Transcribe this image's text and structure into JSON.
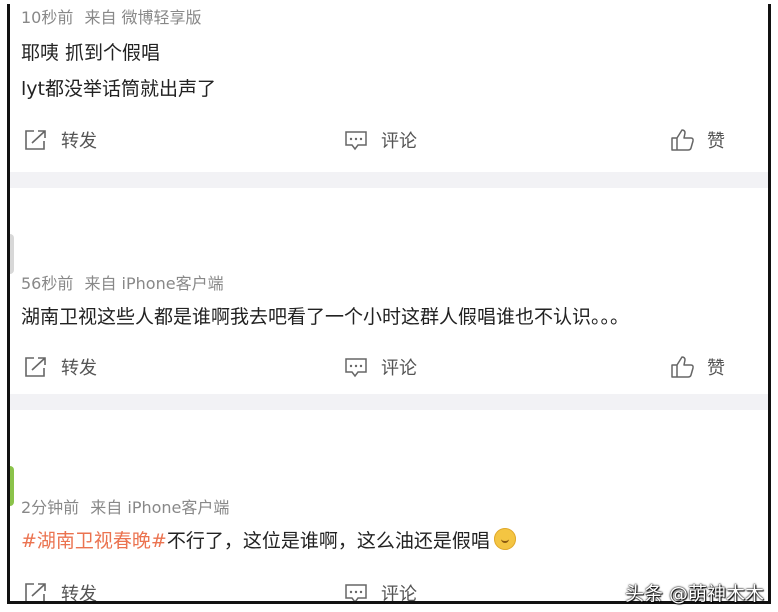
{
  "comments": [
    {
      "time": "10秒前",
      "source": "来自 微博轻享版",
      "lines": [
        "耶咦 抓到个假唱",
        "lyt都没举话筒就出声了"
      ]
    },
    {
      "time": "56秒前",
      "source": "来自 iPhone客户端",
      "lines": [
        "湖南卫视这些人都是谁啊我去吧看了一个小时这群人假唱谁也不认识。。。"
      ]
    },
    {
      "time": "2分钟前",
      "source": "来自 iPhone客户端",
      "hashtag": "#湖南卫视春晚#",
      "text_after_hashtag": "不行了，这位是谁啊，这么油还是假唱"
    }
  ],
  "actions": {
    "forward": "转发",
    "comment": "评论",
    "like": "赞"
  },
  "icons": {
    "forward": "forward-share-icon",
    "comment": "comment-bubble-icon",
    "like": "thumbs-up-icon",
    "emoji": "smirk-emoji-icon"
  },
  "watermark": "头条 @萌神木木",
  "colors": {
    "hashtag": "#eb7350",
    "separator": "#f2f2f5",
    "meta": "#888888"
  }
}
